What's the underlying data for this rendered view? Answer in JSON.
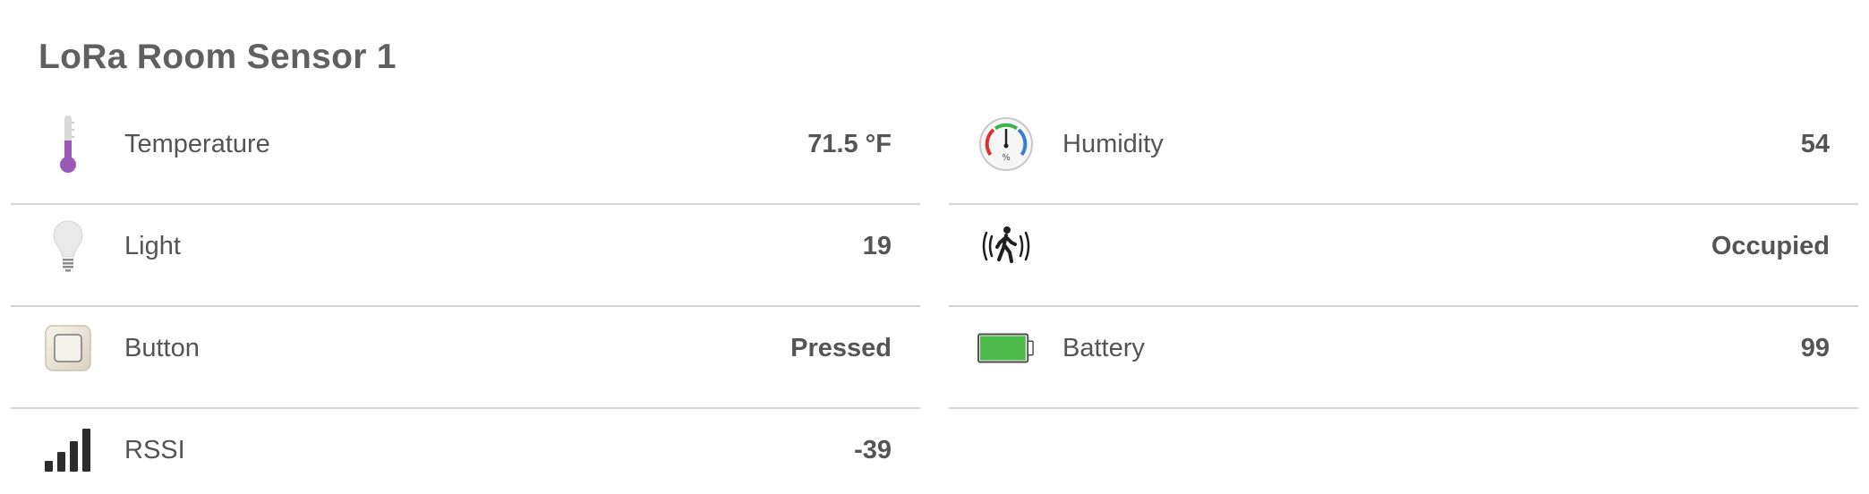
{
  "title": "LoRa Room Sensor 1",
  "left_column": [
    {
      "id": "temperature",
      "icon": "thermometer-icon",
      "label": "Temperature",
      "value": "71.5 °F"
    },
    {
      "id": "light",
      "icon": "lightbulb-icon",
      "label": "Light",
      "value": "19"
    },
    {
      "id": "button",
      "icon": "push-button-icon",
      "label": "Button",
      "value": "Pressed"
    },
    {
      "id": "rssi",
      "icon": "signal-bars-icon",
      "label": "RSSI",
      "value": "-39"
    }
  ],
  "right_column": [
    {
      "id": "humidity",
      "icon": "hygrometer-gauge-icon",
      "label": "Humidity",
      "value": "54"
    },
    {
      "id": "motion",
      "icon": "motion-walker-icon",
      "label": "",
      "value": "Occupied"
    },
    {
      "id": "battery",
      "icon": "battery-icon",
      "label": "Battery",
      "value": "99",
      "level_percent": 99
    }
  ],
  "colors": {
    "thermometer_fill": "#9b59b6",
    "battery_fill": "#4cbb4c",
    "gauge_green": "#3cb34a",
    "gauge_red": "#e03131",
    "gauge_blue": "#3a7bd5",
    "divider": "#d4d4d4"
  }
}
